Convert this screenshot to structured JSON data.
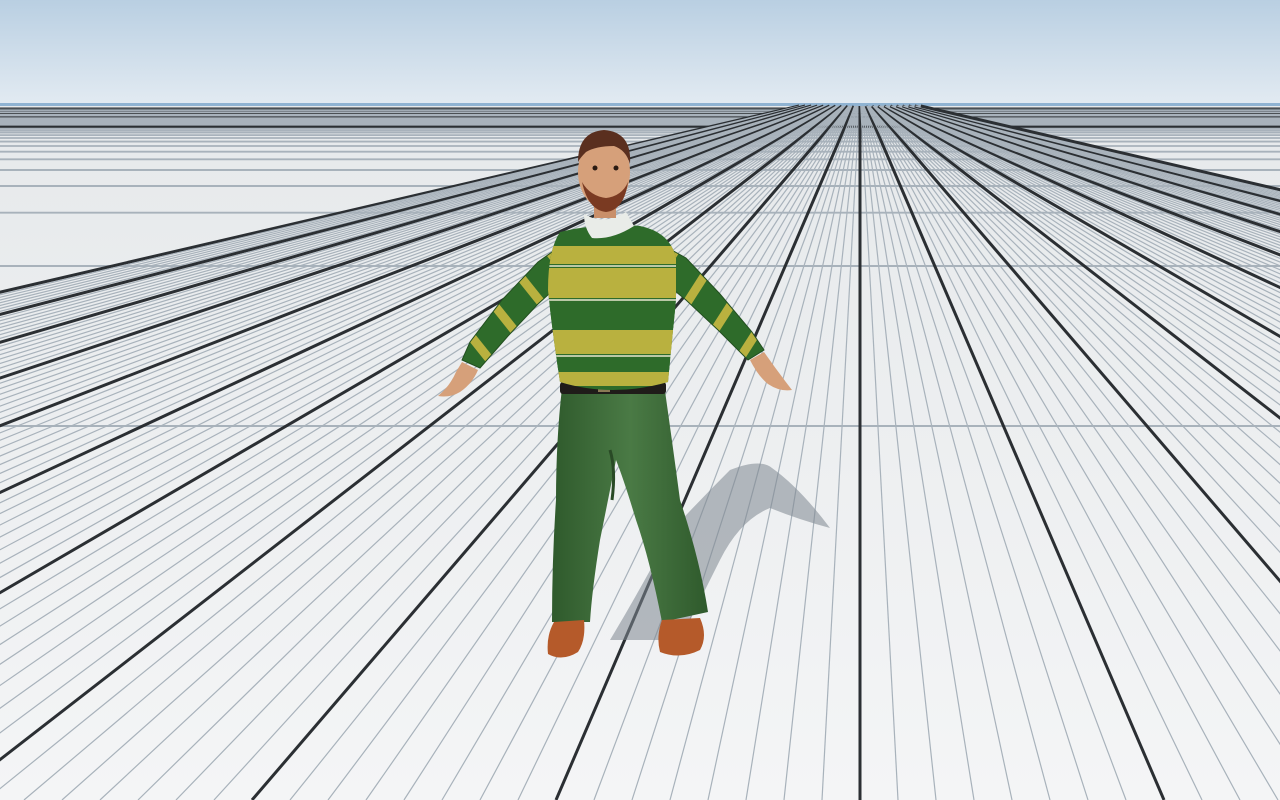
{
  "scene": {
    "type": "3d-viewport",
    "subject": "character-model-t-pose",
    "colors": {
      "sky_top": "#b9cfe2",
      "sky_bottom": "#e3ebf2",
      "horizon": "#8fb3d2",
      "floor": "#f0f2f3",
      "grid_minor": "#a8b2bb",
      "grid_major": "#2b2f33",
      "shirt_green": "#2e6b2a",
      "shirt_stripe": "#b9b13f",
      "pants": "#3f6b3a",
      "shoes": "#b55a2a",
      "skin": "#d6a07a",
      "hair": "#5a2f1f",
      "shadow": "#7d8690"
    }
  }
}
